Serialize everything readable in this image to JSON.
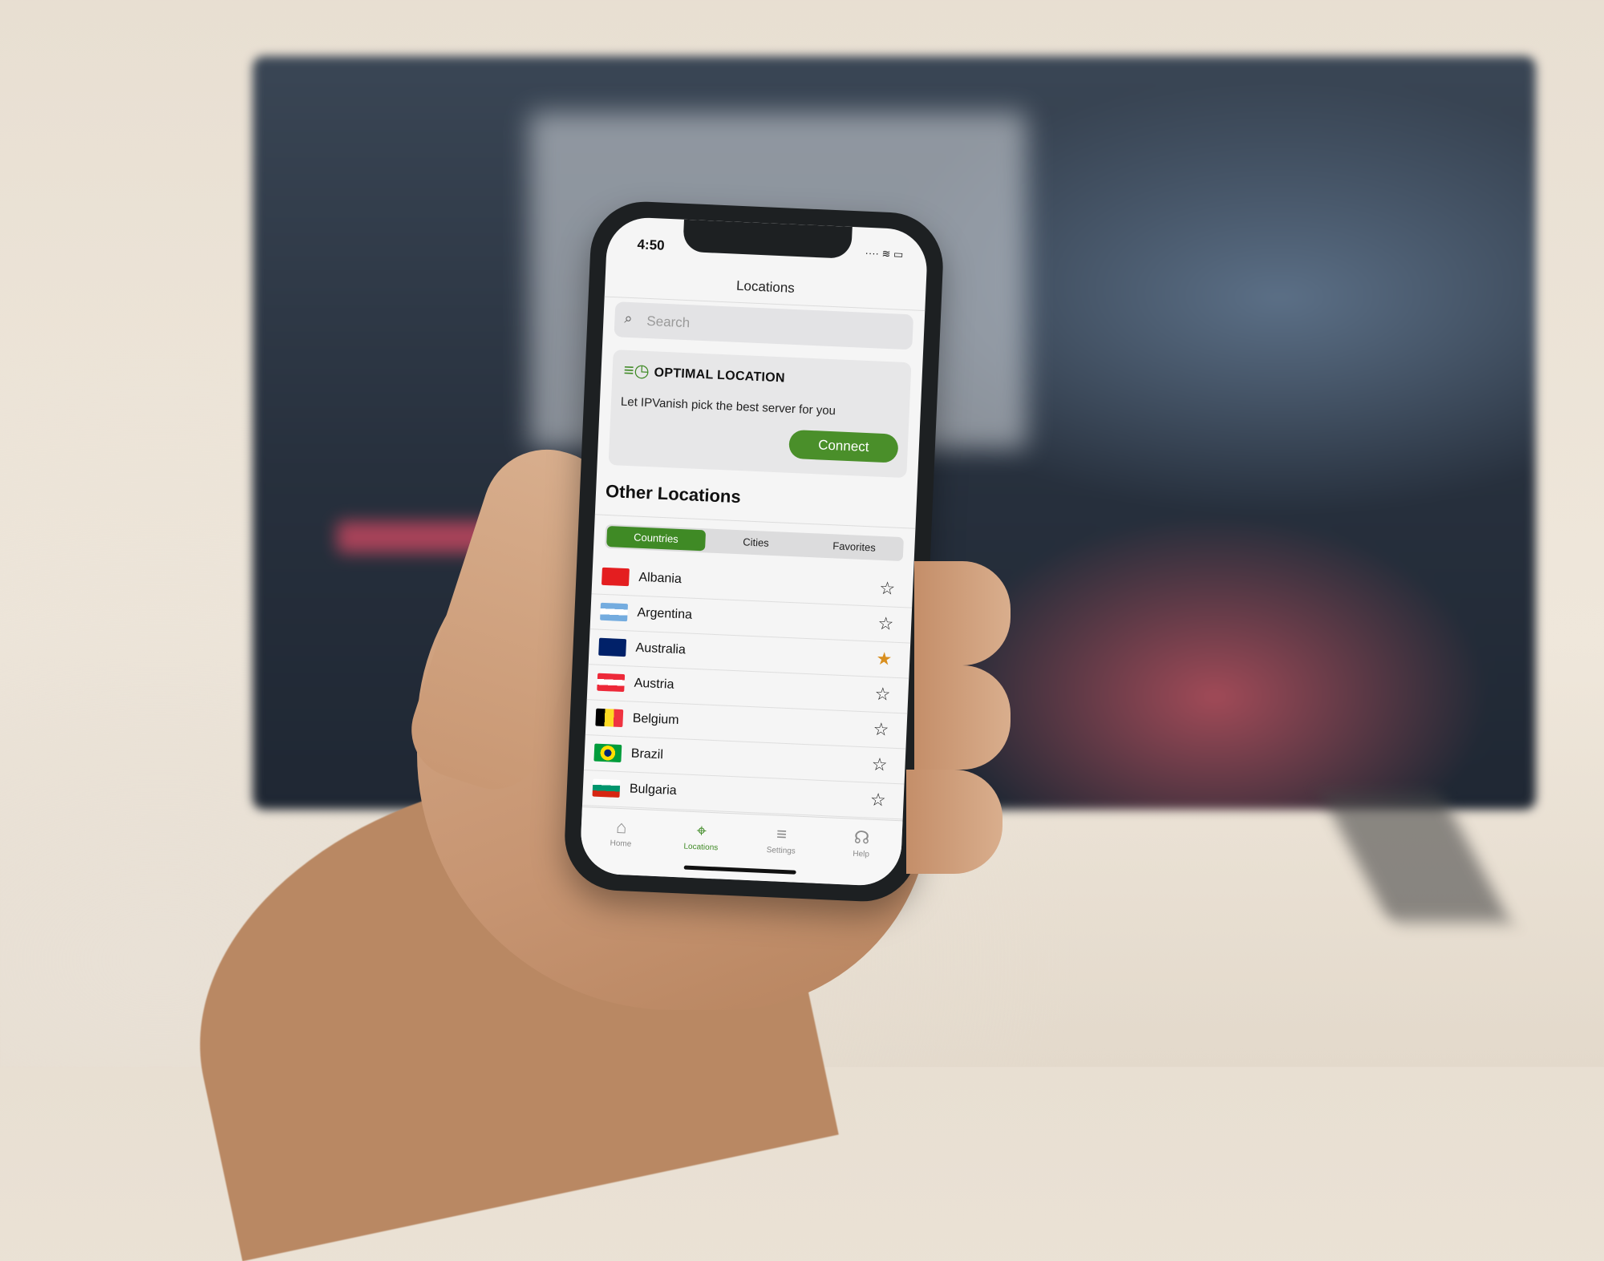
{
  "status_bar": {
    "time": "4:50"
  },
  "nav": {
    "title": "Locations"
  },
  "search": {
    "placeholder": "Search"
  },
  "optimal": {
    "title": "OPTIMAL LOCATION",
    "description": "Let IPVanish pick the best server for you",
    "connect_label": "Connect"
  },
  "other_locations": {
    "title": "Other Locations",
    "tabs": [
      {
        "label": "Countries",
        "selected": true
      },
      {
        "label": "Cities",
        "selected": false
      },
      {
        "label": "Favorites",
        "selected": false
      }
    ],
    "countries": [
      {
        "name": "Albania",
        "favorite": false
      },
      {
        "name": "Argentina",
        "favorite": false
      },
      {
        "name": "Australia",
        "favorite": true
      },
      {
        "name": "Austria",
        "favorite": false
      },
      {
        "name": "Belgium",
        "favorite": false
      },
      {
        "name": "Brazil",
        "favorite": false
      },
      {
        "name": "Bulgaria",
        "favorite": false
      }
    ]
  },
  "tab_bar": [
    {
      "label": "Home",
      "icon": "home-icon",
      "active": false
    },
    {
      "label": "Locations",
      "icon": "location-pin-icon",
      "active": true
    },
    {
      "label": "Settings",
      "icon": "sliders-icon",
      "active": false
    },
    {
      "label": "Help",
      "icon": "headset-icon",
      "active": false
    }
  ],
  "colors": {
    "accent": "#3f8a25",
    "favorite_star": "#d98f1f"
  }
}
